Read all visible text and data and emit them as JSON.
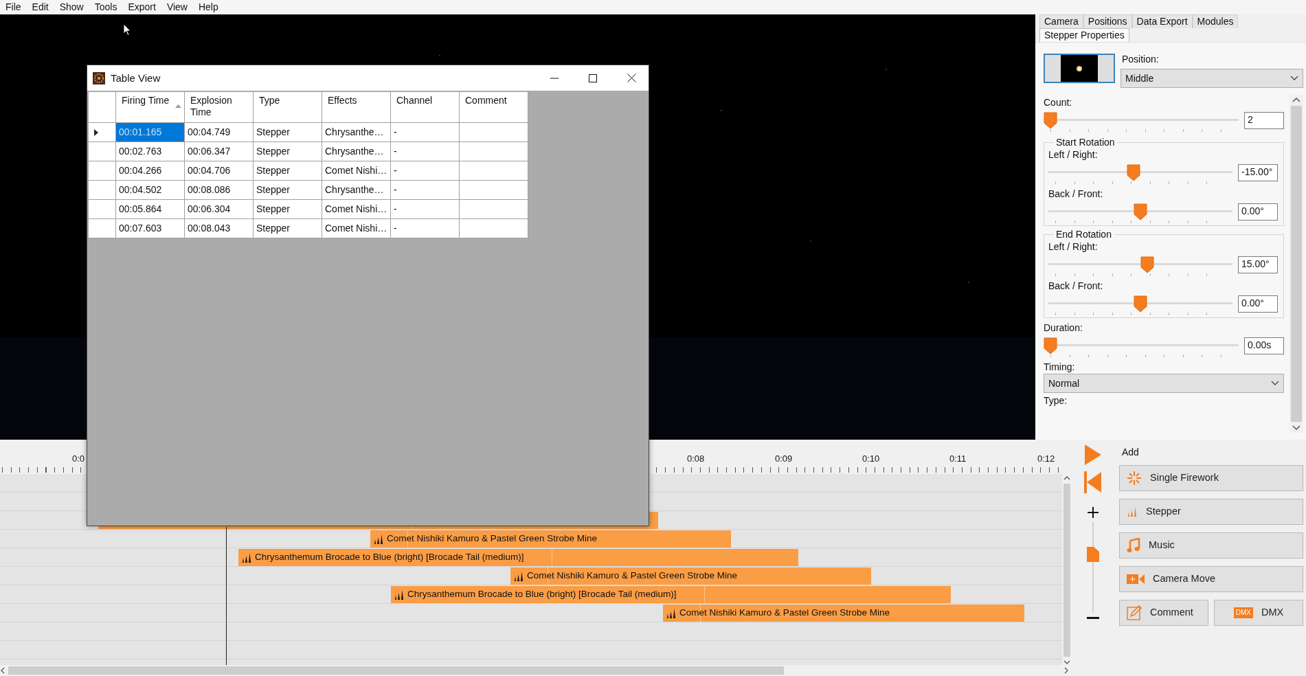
{
  "menu": [
    "File",
    "Edit",
    "Show",
    "Tools",
    "Export",
    "View",
    "Help"
  ],
  "table_view": {
    "title": "Table View",
    "columns": [
      {
        "label": "Firing Time",
        "sorted": true
      },
      {
        "label": "Explosion Time",
        "sorted": false
      },
      {
        "label": "Type",
        "sorted": false
      },
      {
        "label": "Effects",
        "sorted": false
      },
      {
        "label": "Channel",
        "sorted": false
      },
      {
        "label": "Comment",
        "sorted": false
      }
    ],
    "rows": [
      {
        "current": true,
        "cells": [
          {
            "text": "00:01.165",
            "selected": true
          },
          {
            "text": "00:04.749",
            "selected": false
          },
          {
            "text": "Stepper",
            "selected": false
          },
          {
            "text": "Chrysanthe…",
            "selected": false
          },
          {
            "text": "-",
            "selected": false
          }
        ]
      },
      {
        "current": false,
        "cells": [
          {
            "text": "00:02.763",
            "selected": false
          },
          {
            "text": "00:06.347",
            "selected": false
          },
          {
            "text": "Stepper",
            "selected": false
          },
          {
            "text": "Chrysanthe…",
            "selected": false
          },
          {
            "text": "-",
            "selected": false
          }
        ]
      },
      {
        "current": false,
        "cells": [
          {
            "text": "00:04.266",
            "selected": false
          },
          {
            "text": "00:04.706",
            "selected": false
          },
          {
            "text": "Stepper",
            "selected": false
          },
          {
            "text": "Comet Nishi…",
            "selected": false
          },
          {
            "text": "-",
            "selected": false
          }
        ]
      },
      {
        "current": false,
        "cells": [
          {
            "text": "00:04.502",
            "selected": false
          },
          {
            "text": "00:08.086",
            "selected": false
          },
          {
            "text": "Stepper",
            "selected": false
          },
          {
            "text": "Chrysanthe…",
            "selected": false
          },
          {
            "text": "-",
            "selected": false
          }
        ]
      },
      {
        "current": false,
        "cells": [
          {
            "text": "00:05.864",
            "selected": false
          },
          {
            "text": "00:06.304",
            "selected": false
          },
          {
            "text": "Stepper",
            "selected": false
          },
          {
            "text": "Comet Nishi…",
            "selected": false
          },
          {
            "text": "-",
            "selected": false
          }
        ]
      },
      {
        "current": false,
        "cells": [
          {
            "text": "00:07.603",
            "selected": false
          },
          {
            "text": "00:08.043",
            "selected": false
          },
          {
            "text": "Stepper",
            "selected": false
          },
          {
            "text": "Comet Nishi…",
            "selected": false
          },
          {
            "text": "-",
            "selected": false
          }
        ]
      }
    ]
  },
  "properties": {
    "tabs": [
      {
        "label": "Camera",
        "selected": false
      },
      {
        "label": "Positions",
        "selected": false
      },
      {
        "label": "Data Export",
        "selected": false
      },
      {
        "label": "Modules",
        "selected": false
      },
      {
        "label": "Stepper Properties",
        "selected": true
      }
    ],
    "position_label": "Position:",
    "position": "Middle",
    "controls": [
      {
        "kind": "slider",
        "label": "Count:",
        "level": 0,
        "value": "2"
      },
      {
        "kind": "group",
        "title": "Start Rotation",
        "children": [
          {
            "kind": "slider",
            "label": "Left / Right:",
            "level": 0.46,
            "value": "-15.00°"
          },
          {
            "kind": "slider",
            "label": "Back / Front:",
            "level": 0.5,
            "value": "0.00°"
          }
        ]
      },
      {
        "kind": "group",
        "title": "End Rotation",
        "children": [
          {
            "kind": "slider",
            "label": "Left / Right:",
            "level": 0.54,
            "value": "15.00°"
          },
          {
            "kind": "slider",
            "label": "Back / Front:",
            "level": 0.5,
            "value": "0.00°"
          }
        ]
      },
      {
        "kind": "slider",
        "label": "Duration:",
        "level": 0,
        "value": "0.00s"
      },
      {
        "kind": "dropdown",
        "label": "Timing:",
        "value": "Normal"
      },
      {
        "kind": "label",
        "label": "Type:"
      }
    ]
  },
  "timeline": {
    "ruler": [
      "0:0",
      "0:08",
      "0:09",
      "0:10",
      "0:11",
      "0:12"
    ],
    "tracks": [
      {
        "kind": "stepper"
      },
      {
        "kind": "stepper",
        "label": "Comet Nishiki Kamuro & Pastel Green Strobe Mine"
      },
      {
        "kind": "stepper",
        "label": "Chrysanthemum Brocade to Blue (bright) [Brocade Tail (medium)]"
      },
      {
        "kind": "stepper",
        "label": "Comet Nishiki Kamuro & Pastel Green Strobe Mine"
      },
      {
        "kind": "stepper",
        "label": "Chrysanthemum Brocade to Blue (bright) [Brocade Tail (medium)]"
      },
      {
        "kind": "stepper",
        "label": "Comet Nishiki Kamuro & Pastel Green Strobe Mine"
      }
    ]
  },
  "zoom_slider": {
    "level": 0.68
  },
  "add_panel": {
    "title": "Add",
    "buttons": [
      {
        "kind": "firework",
        "label": "Single Firework"
      },
      {
        "kind": "stepper",
        "label": "Stepper"
      },
      {
        "kind": "music",
        "label": "Music"
      },
      {
        "kind": "camera",
        "label": "Camera Move"
      },
      {
        "kind": "comment",
        "label": "Comment"
      },
      {
        "kind": "dmx",
        "label": "DMX",
        "badge": "DMX"
      }
    ]
  }
}
